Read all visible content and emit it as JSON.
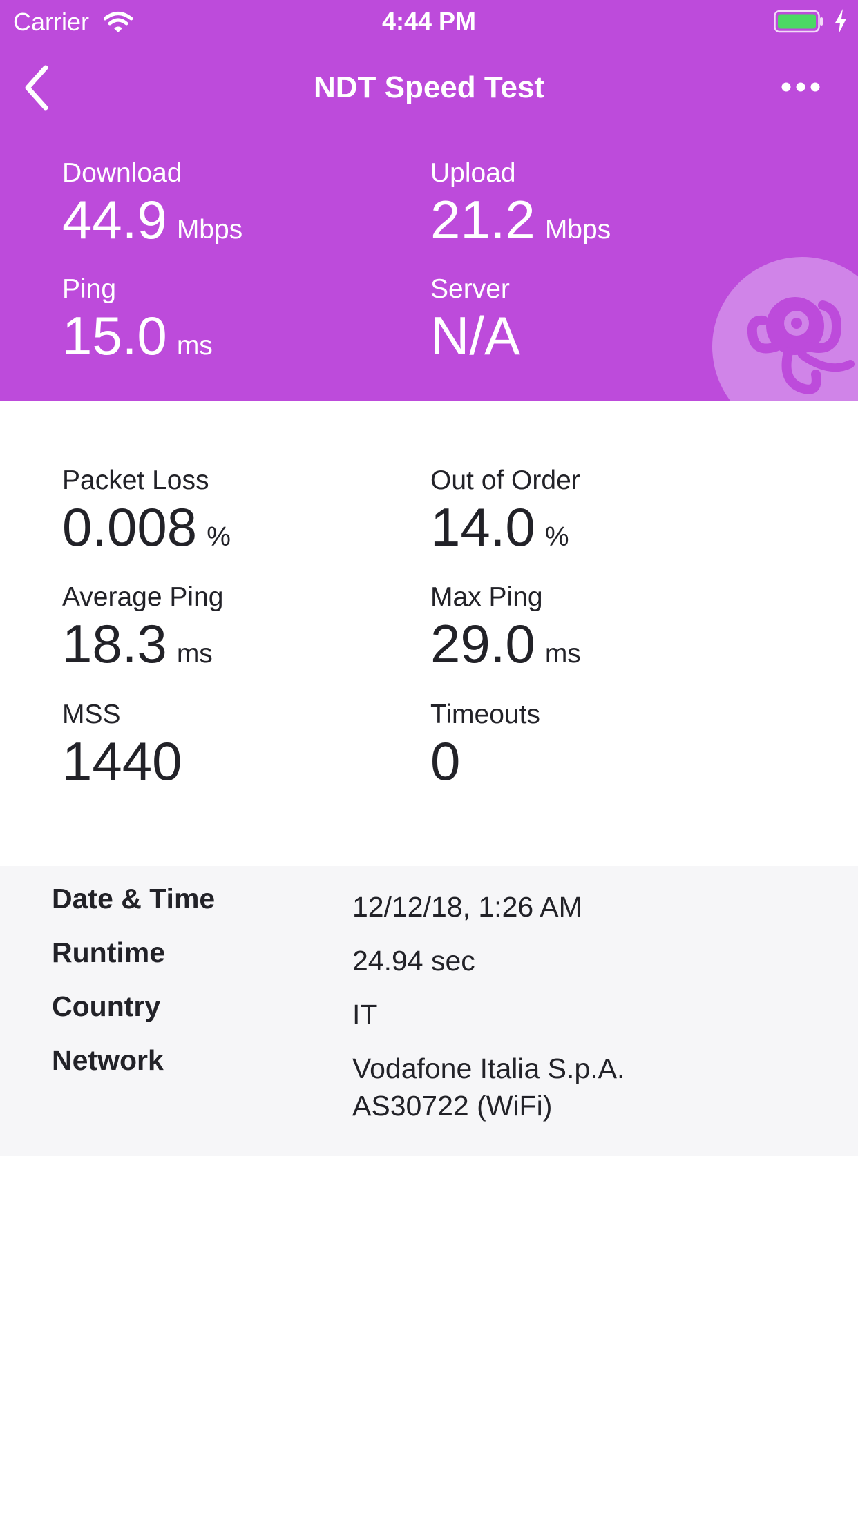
{
  "status_bar": {
    "carrier": "Carrier",
    "time": "4:44 PM"
  },
  "nav": {
    "title": "NDT Speed Test",
    "back_icon": "chevron-left-icon",
    "more_icon": "more-horizontal-icon"
  },
  "summary": {
    "download": {
      "label": "Download",
      "value": "44.9",
      "unit": "Mbps"
    },
    "upload": {
      "label": "Upload",
      "value": "21.2",
      "unit": "Mbps"
    },
    "ping": {
      "label": "Ping",
      "value": "15.0",
      "unit": "ms"
    },
    "server": {
      "label": "Server",
      "value": "N/A"
    }
  },
  "metrics": {
    "packet_loss": {
      "label": "Packet Loss",
      "value": "0.008",
      "unit": "%"
    },
    "out_of_order": {
      "label": "Out of Order",
      "value": "14.0",
      "unit": "%"
    },
    "average_ping": {
      "label": "Average Ping",
      "value": "18.3",
      "unit": "ms"
    },
    "max_ping": {
      "label": "Max Ping",
      "value": "29.0",
      "unit": "ms"
    },
    "mss": {
      "label": "MSS",
      "value": "1440"
    },
    "timeouts": {
      "label": "Timeouts",
      "value": "0"
    }
  },
  "details": {
    "date_time": {
      "label": "Date & Time",
      "value": "12/12/18, 1:26 AM"
    },
    "runtime": {
      "label": "Runtime",
      "value": "24.94 sec"
    },
    "country": {
      "label": "Country",
      "value": "IT"
    },
    "network": {
      "label": "Network",
      "value_line1": "Vodafone Italia S.p.A.",
      "value_line2": "AS30722 (WiFi)"
    }
  },
  "colors": {
    "header": "#bd4bdb",
    "details_bg": "#f6f6f8",
    "battery": "#4cd964"
  }
}
